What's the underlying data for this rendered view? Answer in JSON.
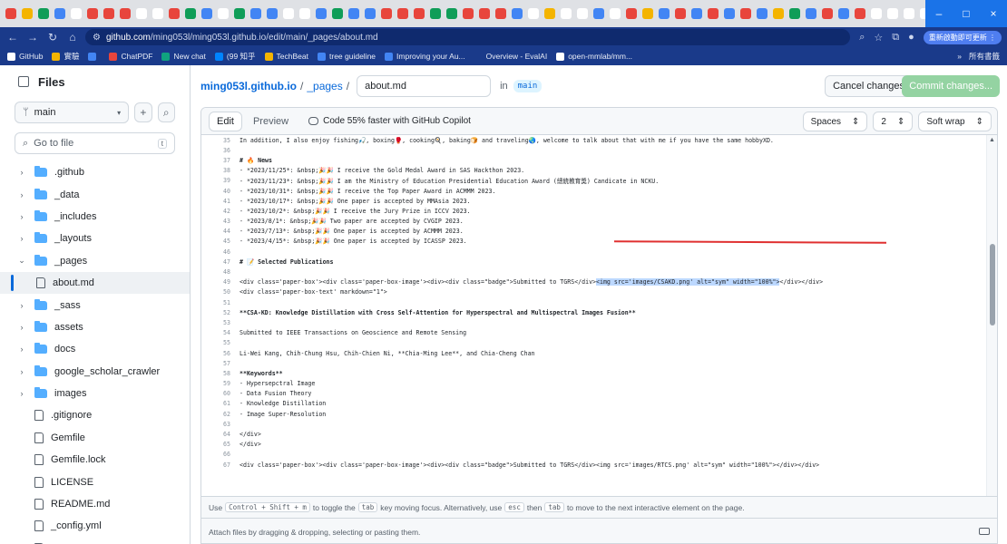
{
  "browser": {
    "tab_close_glyph": "×",
    "tab_new_glyph": "+",
    "tab_colors": [
      "#e8453c",
      "#f4b400",
      "#0f9d58",
      "#4285f4",
      "#ffffff",
      "#e8453c",
      "#e8453c",
      "#e8453c",
      "#ffffff",
      "#ffffff",
      "#e8453c",
      "#0f9d58",
      "#4285f4",
      "#ffffff",
      "#0f9d58",
      "#4285f4",
      "#4285f4",
      "#ffffff",
      "#ffffff",
      "#4285f4",
      "#0f9d58",
      "#4285f4",
      "#4285f4",
      "#e8453c",
      "#e8453c",
      "#e8453c",
      "#0f9d58",
      "#0f9d58",
      "#e8453c",
      "#e8453c",
      "#e8453c",
      "#4285f4",
      "#ffffff",
      "#f4b400",
      "#ffffff",
      "#ffffff",
      "#4285f4",
      "#ffffff",
      "#e8453c",
      "#f4b400",
      "#4285f4",
      "#e8453c",
      "#4285f4",
      "#e8453c",
      "#4285f4",
      "#e8453c",
      "#4285f4",
      "#f4b400",
      "#0f9d58",
      "#4285f4",
      "#e8453c",
      "#4285f4",
      "#e8453c",
      "#ffffff",
      "#ffffff",
      "#ffffff",
      "#ffffff"
    ],
    "window_buttons": [
      "–",
      "□",
      "×"
    ],
    "url_host": "github.com",
    "url_path": "/ming053l/ming053l.github.io/edit/main/_pages/about.md",
    "update_label": "重新啟動即可更新 ⋮",
    "bookmarks": [
      {
        "label": "GitHub",
        "color": "#ffffff"
      },
      {
        "label": "實驗",
        "color": "#f4b400"
      },
      {
        "label": "",
        "color": "#4285f4"
      },
      {
        "label": "ChatPDF",
        "color": "#e8453c"
      },
      {
        "label": "New chat",
        "color": "#10a37f"
      },
      {
        "label": "(99 知乎",
        "color": "#0084ff"
      },
      {
        "label": "TechBeat",
        "color": "#f4b400"
      },
      {
        "label": "tree guideline",
        "color": "#4285f4"
      },
      {
        "label": "Improving your Au...",
        "color": "#4285f4"
      },
      {
        "label": "Overview - EvalAI",
        "color": "#1a3a8a"
      },
      {
        "label": "open-mmlab/mm...",
        "color": "#ffffff"
      }
    ],
    "bookmarks_more": "»",
    "all_bookmarks": "所有書籤"
  },
  "sidebar": {
    "title": "Files",
    "branch": "main",
    "goto_placeholder": "Go to file",
    "goto_shortcut": "t",
    "items": [
      {
        "label": ".github",
        "type": "folder",
        "chevron": "›"
      },
      {
        "label": "_data",
        "type": "folder",
        "chevron": "›"
      },
      {
        "label": "_includes",
        "type": "folder",
        "chevron": "›"
      },
      {
        "label": "_layouts",
        "type": "folder",
        "chevron": "›"
      },
      {
        "label": "_pages",
        "type": "folder",
        "chevron": "⌄"
      },
      {
        "label": "about.md",
        "type": "file",
        "nested": true,
        "selected": true
      },
      {
        "label": "_sass",
        "type": "folder",
        "chevron": "›"
      },
      {
        "label": "assets",
        "type": "folder",
        "chevron": "›"
      },
      {
        "label": "docs",
        "type": "folder",
        "chevron": "›"
      },
      {
        "label": "google_scholar_crawler",
        "type": "folder",
        "chevron": "›"
      },
      {
        "label": "images",
        "type": "folder",
        "chevron": "›"
      },
      {
        "label": ".gitignore",
        "type": "file"
      },
      {
        "label": "Gemfile",
        "type": "file"
      },
      {
        "label": "Gemfile.lock",
        "type": "file"
      },
      {
        "label": "LICENSE",
        "type": "file"
      },
      {
        "label": "README.md",
        "type": "file"
      },
      {
        "label": "_config.yml",
        "type": "file"
      },
      {
        "label": "run_server.sh",
        "type": "file"
      }
    ]
  },
  "main": {
    "repo": "ming053l.github.io",
    "sep": "/",
    "folder": "_pages",
    "filename": "about.md",
    "in_label": "in",
    "branch_badge": "main",
    "cancel_label": "Cancel changes",
    "commit_label": "Commit changes...",
    "tabs": {
      "edit": "Edit",
      "preview": "Preview"
    },
    "copilot": "Code 55% faster with GitHub Copilot",
    "indent_mode": "Spaces",
    "indent_size": "2",
    "wrap_mode": "Soft wrap",
    "hint": {
      "use": "Use",
      "key1": "Control + Shift + m",
      "t1": "to toggle the",
      "key2": "tab",
      "t2": "key moving focus. Alternatively, use",
      "key3": "esc",
      "t3": "then",
      "key4": "tab",
      "t4": "to move to the next interactive element on the page."
    },
    "attach": "Attach files by dragging & dropping, selecting or pasting them."
  },
  "code_lines": [
    {
      "n": "35",
      "t": "In addition, I also enjoy fishing🎣, boxing🥊, cooking🍳, baking🍞 and traveling🌏, welcome to talk about that with me if you have the same hobbyXD."
    },
    {
      "n": "36",
      "t": ""
    },
    {
      "n": "37",
      "t": "# 🔥 News",
      "b": true
    },
    {
      "n": "38",
      "t": "- *2023/11/25*: &nbsp;🎉🎉 I receive the Gold Medal Award in SAS Hackthon 2023."
    },
    {
      "n": "39",
      "t": "- *2023/11/23*: &nbsp;🎉🎉 I am the Ministry of Education Presidential Education Award (總統教育獎) Candicate in NCKU."
    },
    {
      "n": "40",
      "t": "- *2023/10/31*: &nbsp;🎉🎉 I receive the Top Paper Award in ACMMM 2023."
    },
    {
      "n": "41",
      "t": "- *2023/10/17*: &nbsp;🎉🎉 One paper is accepted by MMAsia 2023."
    },
    {
      "n": "42",
      "t": "- *2023/10/2*: &nbsp;🎉🎉 I receive the Jury Prize in ICCV 2023."
    },
    {
      "n": "43",
      "t": "- *2023/8/1*: &nbsp;🎉🎉 Two paper are accepted by CVGIP 2023."
    },
    {
      "n": "44",
      "t": "- *2023/7/13*: &nbsp;🎉🎉 One paper is accepted by ACMMM 2023."
    },
    {
      "n": "45",
      "t": "- *2023/4/15*: &nbsp;🎉🎉 One paper is accepted by ICASSP 2023."
    },
    {
      "n": "46",
      "t": ""
    },
    {
      "n": "47",
      "t": "# 📝 Selected Publications",
      "b": true
    },
    {
      "n": "48",
      "t": ""
    },
    {
      "n": "49",
      "t": "<div class='paper-box'><div class='paper-box-image'><div><div class=\"badge\">Submitted to TGRS</div>",
      "hl": "<img src='images/CSAKD.png' alt=\"sym\" width=\"100%\">",
      "tail": "</div></div>"
    },
    {
      "n": "50",
      "t": "<div class='paper-box-text' markdown=\"1\">"
    },
    {
      "n": "51",
      "t": ""
    },
    {
      "n": "52",
      "t": "**CSA-KD: Knowledge Distillation with Cross Self-Attention for Hyperspectral and Multispectral Images Fusion**",
      "b": true
    },
    {
      "n": "53",
      "t": ""
    },
    {
      "n": "54",
      "t": "Submitted to IEEE Transactions on Geoscience and Remote Sensing"
    },
    {
      "n": "55",
      "t": ""
    },
    {
      "n": "56",
      "t": "Li-Wei Kang, Chih-Chung Hsu, Chih-Chien Ni, **Chia-Ming Lee**, and Chia-Cheng Chan"
    },
    {
      "n": "57",
      "t": ""
    },
    {
      "n": "58",
      "t": "**Keywords**",
      "b": true
    },
    {
      "n": "59",
      "t": "- Hypersepctral Image"
    },
    {
      "n": "60",
      "t": "- Data Fusion Theory"
    },
    {
      "n": "61",
      "t": "- Knowledge Distillation"
    },
    {
      "n": "62",
      "t": "- Image Super-Resolution"
    },
    {
      "n": "63",
      "t": ""
    },
    {
      "n": "64",
      "t": "</div>"
    },
    {
      "n": "65",
      "t": "</div>"
    },
    {
      "n": "66",
      "t": ""
    },
    {
      "n": "67",
      "t": "<div class='paper-box'><div class='paper-box-image'><div><div class=\"badge\">Submitted to TGRS</div><img src='images/RTCS.png' alt=\"sym\" width=\"100%\"></div></div>"
    }
  ]
}
